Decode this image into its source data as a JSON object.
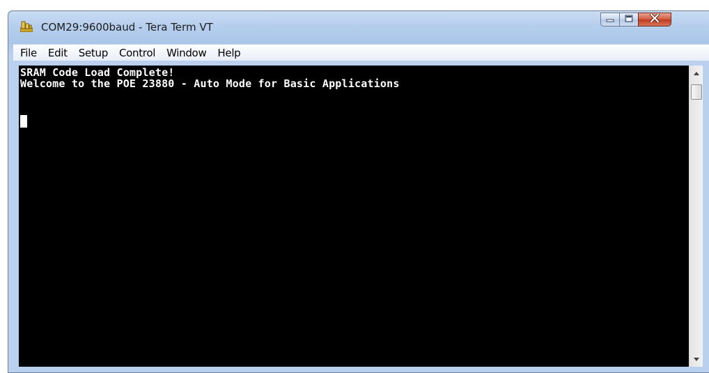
{
  "window": {
    "title": "COM29:9600baud - Tera Term VT"
  },
  "menu": {
    "items": [
      "File",
      "Edit",
      "Setup",
      "Control",
      "Window",
      "Help"
    ]
  },
  "terminal": {
    "lines": [
      "SRAM Code Load Complete!",
      "Welcome to the POE 23880 - Auto Mode for Basic Applications"
    ]
  },
  "icons": {
    "app": "tera-term-icon",
    "minimize": "minimize-icon",
    "maximize": "maximize-icon",
    "close": "close-icon",
    "scroll_up": "scroll-up-arrow-icon",
    "scroll_down": "scroll-down-arrow-icon"
  },
  "colors": {
    "terminal_bg": "#000000",
    "terminal_fg": "#ffffff",
    "close_button": "#c7432a"
  }
}
